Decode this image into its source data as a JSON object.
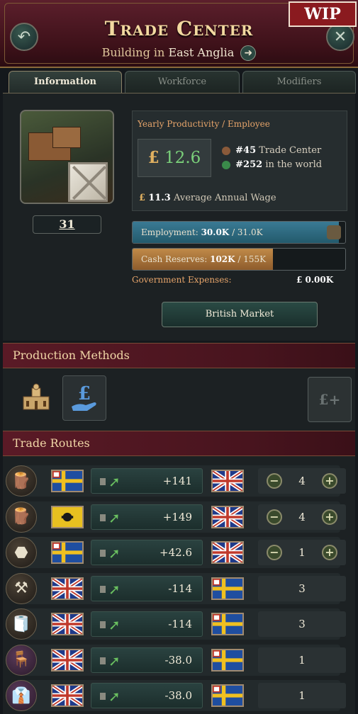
{
  "window": {
    "title": "Trade Center",
    "subtitle_prefix": "Building in",
    "state": "East Anglia",
    "badge": "WIP"
  },
  "icons": {
    "back": "back-arrow-icon",
    "close": "close-icon",
    "goto": "arrow-right-icon"
  },
  "tabs": [
    {
      "label": "Information",
      "active": true
    },
    {
      "label": "Workforce",
      "active": false
    },
    {
      "label": "Modifiers",
      "active": false
    }
  ],
  "building": {
    "level": "31"
  },
  "productivity": {
    "label": "Yearly Productivity / Employee",
    "currency": "£",
    "value": "12.6",
    "rank_type_num": "#45",
    "rank_type_label": "Trade Center",
    "rank_world_num": "#252",
    "rank_world_label": "in the world",
    "wage_value": "11.3",
    "wage_label": "Average Annual Wage"
  },
  "employment": {
    "label": "Employment:",
    "current": "30.0K",
    "max": "/ 31.0K",
    "fill": 0.97
  },
  "cash": {
    "label": "Cash Reserves:",
    "current": "102K",
    "max": "/ 155K",
    "fill": 0.66
  },
  "expenses": {
    "label": "Government Expenses:",
    "value": "£  0.00K"
  },
  "market_button": "British Market",
  "production_methods": {
    "header": "Production Methods",
    "add_icon_text": "£+"
  },
  "trade_routes": {
    "header": "Trade Routes",
    "rows": [
      {
        "good": "wood",
        "from": "sweden",
        "to": "uk",
        "value": "+141",
        "level": "4",
        "controls": true
      },
      {
        "good": "wood",
        "from": "russia",
        "to": "uk",
        "value": "+149",
        "level": "4",
        "controls": true
      },
      {
        "good": "iron",
        "from": "sweden",
        "to": "uk",
        "value": "+42.6",
        "level": "1",
        "controls": true
      },
      {
        "good": "tools",
        "from": "uk",
        "to": "sweden",
        "value": "-114",
        "level": "3",
        "controls": false
      },
      {
        "good": "fabric",
        "from": "uk",
        "to": "sweden",
        "value": "-114",
        "level": "3",
        "controls": false
      },
      {
        "good": "furniture",
        "from": "uk",
        "to": "sweden",
        "value": "-38.0",
        "level": "1",
        "controls": false
      },
      {
        "good": "clothes",
        "from": "uk",
        "to": "sweden",
        "value": "-38.0",
        "level": "1",
        "controls": false
      }
    ]
  },
  "colors": {
    "header_bg": "#3d1119",
    "accent_gold": "#f3d9a0",
    "positive_green": "#7ad07a",
    "employment_bar": "#2e6a80",
    "cash_bar": "#b07a3e"
  }
}
